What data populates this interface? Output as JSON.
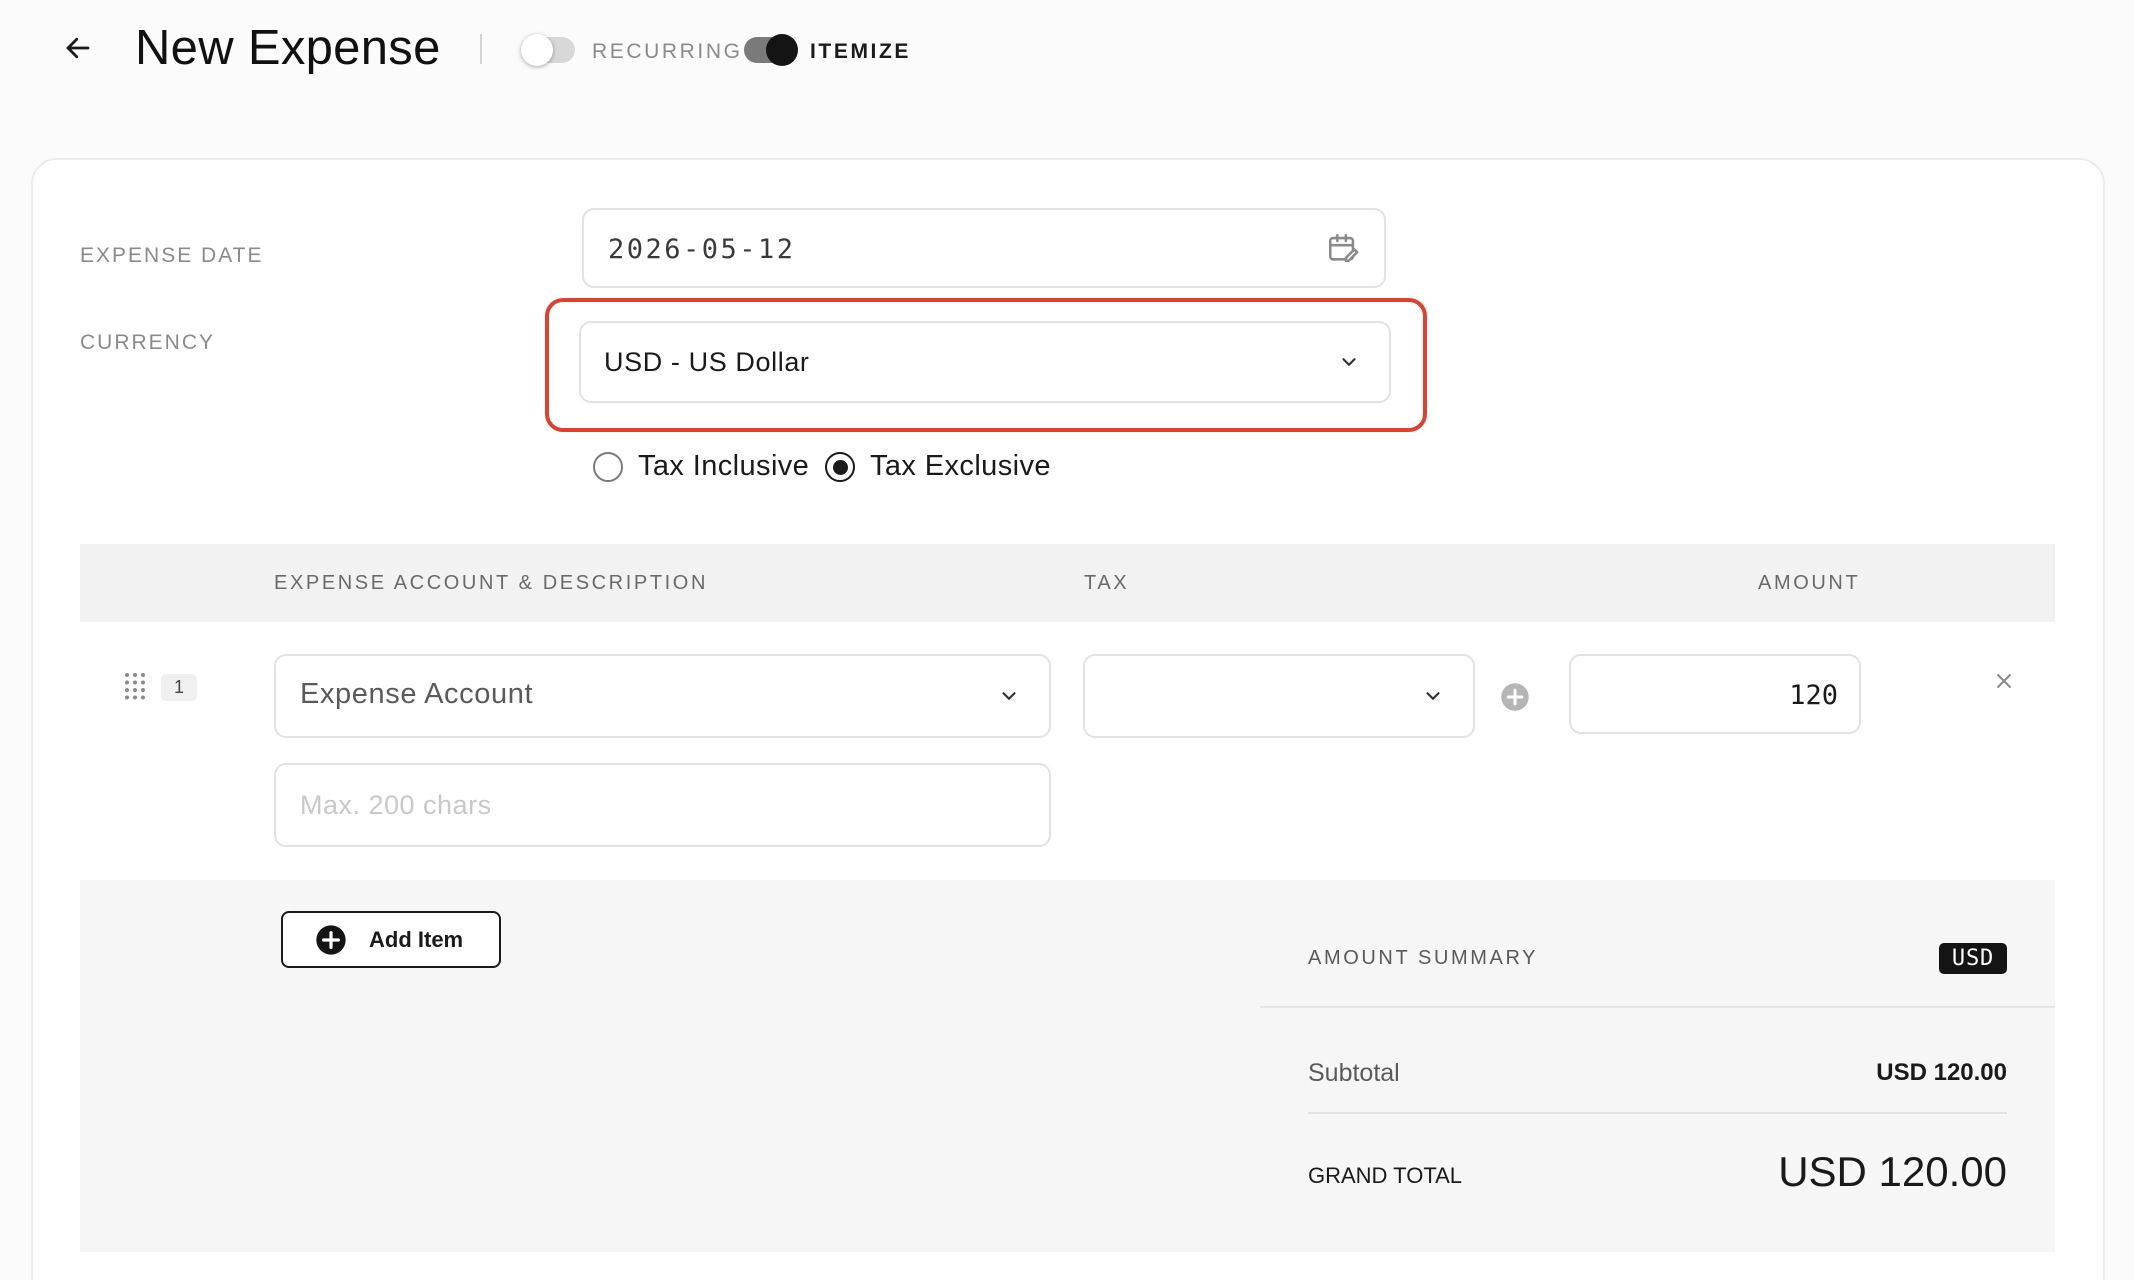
{
  "header": {
    "title": "New Expense",
    "recurring_label": "RECURRING",
    "recurring_on": false,
    "itemize_label": "ITEMIZE",
    "itemize_on": true
  },
  "form": {
    "expense_date_label": "EXPENSE DATE",
    "expense_date_value": "2026-05-12",
    "currency_label": "CURRENCY",
    "currency_value": "USD - US Dollar",
    "tax_options": [
      {
        "label": "Tax Inclusive",
        "selected": false
      },
      {
        "label": "Tax Exclusive",
        "selected": true
      }
    ]
  },
  "table": {
    "headers": {
      "account": "EXPENSE ACCOUNT & DESCRIPTION",
      "tax": "TAX",
      "amount": "AMOUNT"
    },
    "rows": [
      {
        "number": "1",
        "account_placeholder": "Expense Account",
        "description_placeholder": "Max. 200 chars",
        "tax_value": "",
        "amount": "120"
      }
    ]
  },
  "actions": {
    "add_item_label": "Add Item"
  },
  "summary": {
    "title": "AMOUNT SUMMARY",
    "currency_badge": "USD",
    "subtotal_label": "Subtotal",
    "subtotal_value": "USD 120.00",
    "grand_total_label": "GRAND TOTAL",
    "grand_total_value": "USD 120.00"
  },
  "colors": {
    "highlight": "#e0402e",
    "toggle_active": "#141414"
  },
  "icons": {
    "back": "back-arrow-icon",
    "calendar": "calendar-edit-icon",
    "chevron": "chevron-down-icon",
    "drag": "drag-handle-icon",
    "add_tax": "plus-circle-icon",
    "remove": "close-icon",
    "add_item": "plus-circle-icon"
  }
}
